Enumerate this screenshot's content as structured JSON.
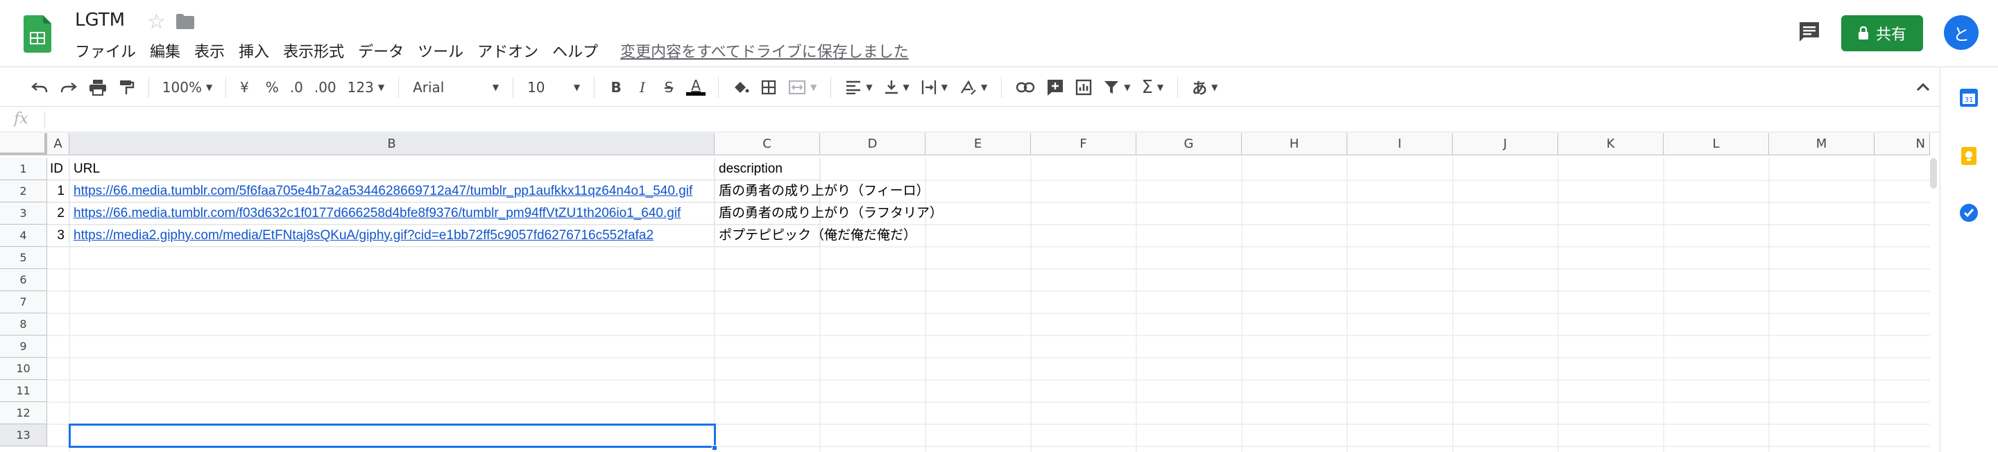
{
  "app": {
    "title": "LGTM",
    "save_status": "変更内容をすべてドライブに保存しました",
    "share_label": "共有",
    "avatar_initial": "と",
    "brand_color": "#1e8e3e",
    "accent_color": "#1a73e8"
  },
  "menu": [
    "ファイル",
    "編集",
    "表示",
    "挿入",
    "表示形式",
    "データ",
    "ツール",
    "アドオン",
    "ヘルプ"
  ],
  "toolbar": {
    "zoom": "100%",
    "currency": "¥",
    "percent": "%",
    "decrease_decimal": ".0",
    "increase_decimal": ".00",
    "number_format": "123",
    "font": "Arial",
    "font_size": "10",
    "bold": "B",
    "italic": "I",
    "strike": "S",
    "text_color": "A",
    "input_tools": "あ",
    "icons": [
      "undo-icon",
      "redo-icon",
      "print-icon",
      "paint-format-icon",
      "fill-color-icon",
      "borders-icon",
      "merge-cells-icon",
      "horizontal-align-icon",
      "vertical-align-icon",
      "text-wrap-icon",
      "text-rotation-icon",
      "link-icon",
      "comment-icon",
      "chart-icon",
      "filter-icon",
      "functions-icon"
    ]
  },
  "formula_bar": {
    "fx_label": "fx",
    "value": ""
  },
  "grid": {
    "columns": [
      "A",
      "B",
      "C",
      "D",
      "E",
      "F",
      "G",
      "H",
      "I",
      "J",
      "K",
      "L",
      "M",
      "N"
    ],
    "rows": [
      "1",
      "2",
      "3",
      "4",
      "5",
      "6",
      "7",
      "8",
      "9",
      "10",
      "11",
      "12",
      "13"
    ],
    "cells": {
      "r1": {
        "a": "ID",
        "b": "URL",
        "c": "description"
      },
      "r2": {
        "a": "1",
        "b": "https://66.media.tumblr.com/5f6faa705e4b7a2a5344628669712a47/tumblr_pp1aufkkx11qz64n4o1_540.gif",
        "c": "盾の勇者の成り上がり（フィーロ）"
      },
      "r3": {
        "a": "2",
        "b": "https://66.media.tumblr.com/f03d632c1f0177d666258d4bfe8f9376/tumblr_pm94ffVtZU1th206io1_640.gif",
        "c": "盾の勇者の成り上がり（ラフタリア）"
      },
      "r4": {
        "a": "3",
        "b": "https://media2.giphy.com/media/EtFNtaj8sQKuA/giphy.gif?cid=e1bb72ff5c9057fd6276716c552fafa2",
        "c": "ポプテピピック（俺だ俺だ俺だ）"
      }
    },
    "selected_cell": "B13"
  },
  "side_panel": {
    "icons": [
      "calendar-icon",
      "keep-icon",
      "tasks-icon"
    ]
  }
}
